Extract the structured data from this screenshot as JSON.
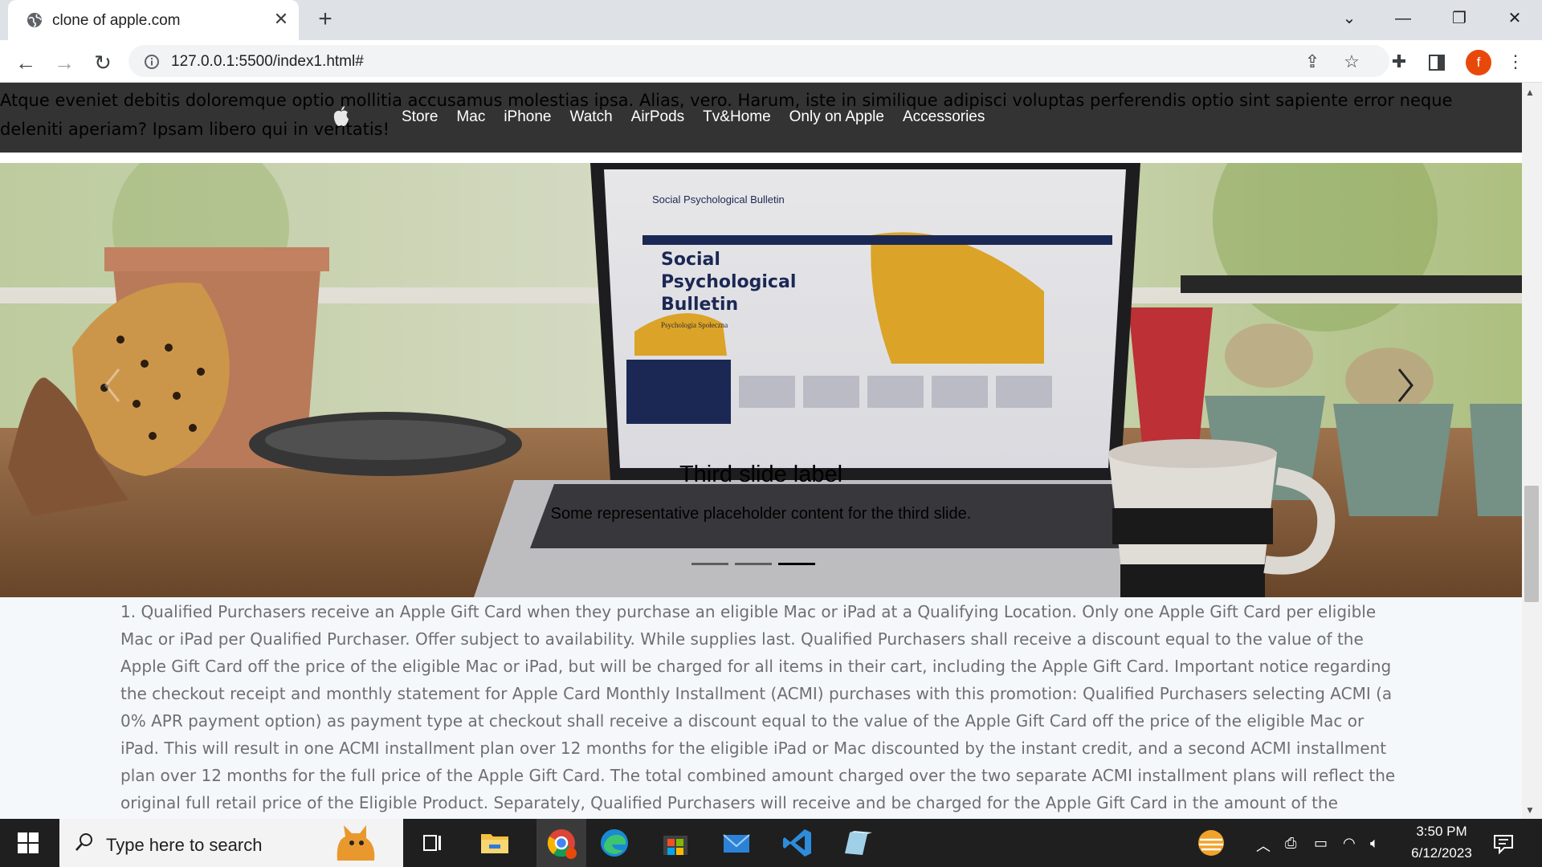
{
  "browser": {
    "tab_title": "clone of apple.com",
    "url": "127.0.0.1:5500/index1.html#"
  },
  "page": {
    "header_text": "Atque eveniet debitis doloremque optio mollitia accusamus molestias ipsa. Alias, vero. Harum, iste in similique adipisci voluptas perferendis optio sint sapiente error neque deleniti aperiam? Ipsam libero qui in veritatis!",
    "nav": [
      "Store",
      "Mac",
      "iPhone",
      "Watch",
      "AirPods",
      "Tv&Home",
      "Only on Apple",
      "Accessories"
    ],
    "carousel": {
      "caption_title": "Third slide label",
      "caption_text": "Some representative placeholder content for the third slide.",
      "indicator_count": 3,
      "active_index": 2,
      "screen_texts": [
        "Social",
        "Psychological",
        "Bulletin",
        "Psychologia Społeczna"
      ]
    },
    "footnote": "1. Qualified Purchasers receive an Apple Gift Card when they purchase an eligible Mac or iPad at a Qualifying Location. Only one Apple Gift Card per eligible Mac or iPad per Qualified Purchaser. Offer subject to availability. While supplies last. Qualified Purchasers shall receive a discount equal to the value of the Apple Gift Card off the price of the eligible Mac or iPad, but will be charged for all items in their cart, including the Apple Gift Card. Important notice regarding the checkout receipt and monthly statement for Apple Card Monthly Installment (ACMI) purchases with this promotion: Qualified Purchasers selecting ACMI (a 0% APR payment option) as payment type at checkout shall receive a discount equal to the value of the Apple Gift Card off the price of the eligible Mac or iPad. This will result in one ACMI installment plan over 12 months for the eligible iPad or Mac discounted by the instant credit, and a second ACMI installment plan over 12 months for the full price of the Apple Gift Card. The total combined amount charged over the two separate ACMI installment plans will reflect the original full retail price of the Eligible Product. Separately, Qualified Purchasers will receive and be charged for the Apple Gift Card in the amount of the applicable discount off the eligible Mac or iPad. ACMI is subject to credit approval and credit limit. Variable APRs for Apple"
  },
  "taskbar": {
    "search_placeholder": "Type here to search",
    "time": "3:50 PM",
    "date": "6/12/2023"
  },
  "profile_initial": "f"
}
